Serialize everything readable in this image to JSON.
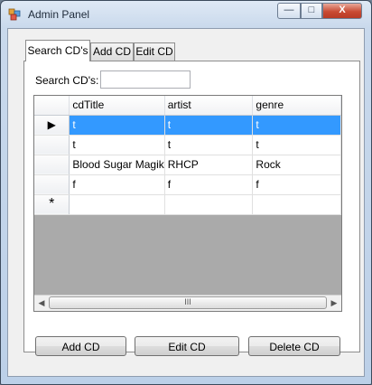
{
  "window": {
    "title": "Admin Panel",
    "controls": {
      "minimize": "—",
      "maximize": "□",
      "close": "X"
    }
  },
  "tabs": [
    {
      "label": "Search CD's"
    },
    {
      "label": "Add CD"
    },
    {
      "label": "Edit CD"
    }
  ],
  "search": {
    "label": "Search CD's:",
    "value": "",
    "placeholder": ""
  },
  "grid": {
    "columns": [
      "cdTitle",
      "artist",
      "genre"
    ],
    "rows": [
      {
        "indicator": "▶",
        "cells": [
          "t",
          "t",
          "t"
        ]
      },
      {
        "indicator": "",
        "cells": [
          "t",
          "t",
          "t"
        ]
      },
      {
        "indicator": "",
        "cells": [
          "Blood Sugar Magik",
          "RHCP",
          "Rock"
        ]
      },
      {
        "indicator": "",
        "cells": [
          "f",
          "f",
          "f"
        ]
      },
      {
        "indicator": "*",
        "cells": [
          "",
          "",
          ""
        ]
      }
    ],
    "scroll": {
      "left_arrow": "◀",
      "right_arrow": "▶",
      "grip": "III"
    }
  },
  "buttons": {
    "add": "Add CD",
    "edit": "Edit CD",
    "delete": "Delete CD"
  },
  "colors": {
    "selection": "#3399ff",
    "grid_background": "#aaaaaa",
    "window_frame": "#bcd0e8"
  }
}
